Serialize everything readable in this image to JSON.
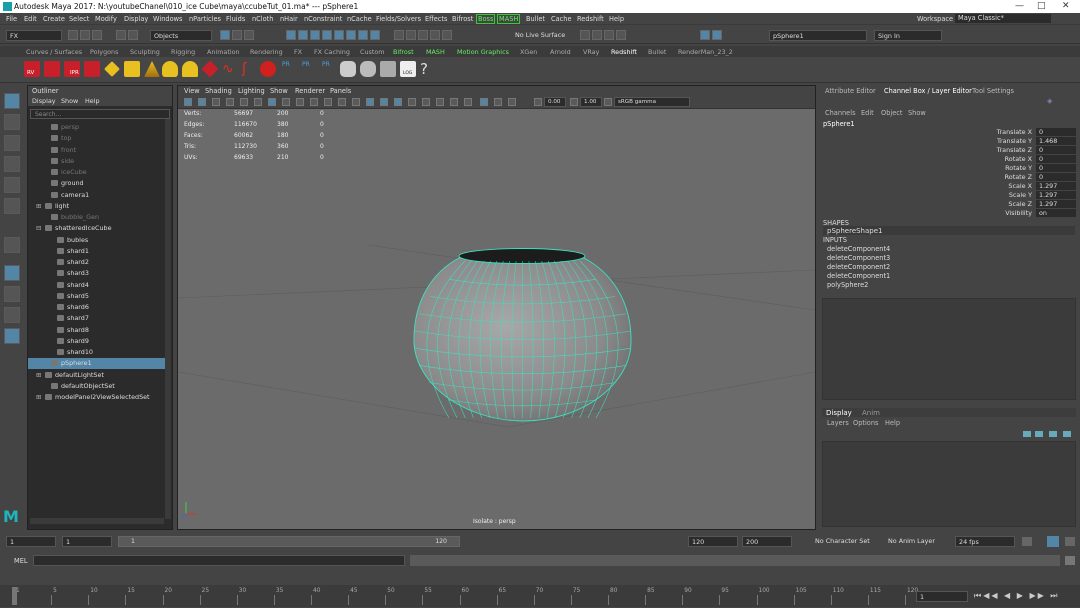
{
  "window": {
    "title": "Autodesk Maya 2017: N:\\youtubeChanel\\010_ice Cube\\maya\\ccubeTut_01.ma*   ---   pSphere1",
    "minimize": "—",
    "maximize": "□",
    "close": "✕"
  },
  "menu": {
    "items": [
      "File",
      "Edit",
      "Create",
      "Select",
      "Modify",
      "Display",
      "Windows",
      "nParticles",
      "Fluids",
      "nCloth",
      "nHair",
      "nConstraint",
      "nCache",
      "Fields/Solvers",
      "Effects",
      "Bifrost",
      "Boss",
      "MASH",
      "Bullet",
      "Cache",
      "Redshift",
      "Help"
    ],
    "workspace_label": "Workspace :",
    "workspace_value": "Maya Classic*"
  },
  "status": {
    "mode": "FX",
    "objects": "Objects",
    "live_surface": "No Live Surface",
    "selection_field": "pSphere1",
    "sign_in": "Sign In"
  },
  "shelf": {
    "tabs": [
      "Curves / Surfaces",
      "Polygons",
      "Sculpting",
      "Rigging",
      "Animation",
      "Rendering",
      "FX",
      "FX Caching",
      "Custom",
      "Bifrost",
      "MASH",
      "Motion Graphics",
      "XGen",
      "Arnold",
      "VRay",
      "Redshift",
      "Bullet",
      "RenderMan_23_2"
    ],
    "active_tab": "Redshift",
    "icon_labels": {
      "rv": "RV",
      "ipr": "IPR",
      "pr1": "PR",
      "pr2": "PR",
      "pr3": "PR",
      "log": "LOG"
    }
  },
  "outliner": {
    "title": "Outliner",
    "menus": [
      "Display",
      "Show",
      "Help"
    ],
    "search_placeholder": "Search...",
    "rows": [
      {
        "label": "persp",
        "dim": true,
        "indent": 1
      },
      {
        "label": "top",
        "dim": true,
        "indent": 1
      },
      {
        "label": "front",
        "dim": true,
        "indent": 1
      },
      {
        "label": "side",
        "dim": true,
        "indent": 1
      },
      {
        "label": "iceCube",
        "dim": true,
        "indent": 1
      },
      {
        "label": "ground",
        "dim": false,
        "indent": 1
      },
      {
        "label": "camera1",
        "dim": false,
        "indent": 1
      },
      {
        "label": "light",
        "dim": false,
        "indent": 0,
        "expander": "+"
      },
      {
        "label": "bubble_Gen",
        "dim": true,
        "indent": 1
      },
      {
        "label": "shatteredIceCube",
        "dim": false,
        "indent": 0,
        "expander": "-"
      },
      {
        "label": "bubles",
        "dim": false,
        "indent": 2
      },
      {
        "label": "shard1",
        "dim": false,
        "indent": 2
      },
      {
        "label": "shard2",
        "dim": false,
        "indent": 2
      },
      {
        "label": "shard3",
        "dim": false,
        "indent": 2
      },
      {
        "label": "shard4",
        "dim": false,
        "indent": 2
      },
      {
        "label": "shard5",
        "dim": false,
        "indent": 2
      },
      {
        "label": "shard6",
        "dim": false,
        "indent": 2
      },
      {
        "label": "shard7",
        "dim": false,
        "indent": 2
      },
      {
        "label": "shard8",
        "dim": false,
        "indent": 2
      },
      {
        "label": "shard9",
        "dim": false,
        "indent": 2
      },
      {
        "label": "shard10",
        "dim": false,
        "indent": 2
      },
      {
        "label": "pSphere1",
        "dim": false,
        "indent": 1,
        "selected": true
      },
      {
        "label": "defaultLightSet",
        "dim": false,
        "indent": 0,
        "expander": "+"
      },
      {
        "label": "defaultObjectSet",
        "dim": false,
        "indent": 1
      },
      {
        "label": "modelPanel2ViewSelectedSet",
        "dim": false,
        "indent": 0,
        "expander": "+"
      }
    ]
  },
  "viewport": {
    "menus": [
      "View",
      "Shading",
      "Lighting",
      "Show",
      "Renderer",
      "Panels"
    ],
    "exposure": "0.00",
    "gamma": "1.00",
    "color_space": "sRGB gamma",
    "footer": "Isolate : persp",
    "hud": [
      {
        "label": "Verts:",
        "a": "56697",
        "b": "200",
        "c": "0"
      },
      {
        "label": "Edges:",
        "a": "116670",
        "b": "380",
        "c": "0"
      },
      {
        "label": "Faces:",
        "a": "60062",
        "b": "180",
        "c": "0"
      },
      {
        "label": "Tris:",
        "a": "112730",
        "b": "360",
        "c": "0"
      },
      {
        "label": "UVs:",
        "a": "69633",
        "b": "210",
        "c": "0"
      }
    ]
  },
  "right_panel": {
    "tabs": [
      "Attribute Editor",
      "Channel Box / Layer Editor",
      "Tool Settings"
    ],
    "active_tab": "Channel Box / Layer Editor",
    "menus": [
      "Channels",
      "Edit",
      "Object",
      "Show"
    ],
    "object": "pSphere1",
    "channels": [
      {
        "label": "Translate X",
        "value": "0"
      },
      {
        "label": "Translate Y",
        "value": "1.468"
      },
      {
        "label": "Translate Z",
        "value": "0"
      },
      {
        "label": "Rotate X",
        "value": "0"
      },
      {
        "label": "Rotate Y",
        "value": "0"
      },
      {
        "label": "Rotate Z",
        "value": "0"
      },
      {
        "label": "Scale X",
        "value": "1.297"
      },
      {
        "label": "Scale Y",
        "value": "1.297"
      },
      {
        "label": "Scale Z",
        "value": "1.297"
      },
      {
        "label": "Visibility",
        "value": "on"
      }
    ],
    "shapes_header": "SHAPES",
    "shape": "pSphereShape1",
    "inputs_header": "INPUTS",
    "inputs": [
      "deleteComponent4",
      "deleteComponent3",
      "deleteComponent2",
      "deleteComponent1",
      "polySphere2"
    ],
    "layer_tabs": [
      "Display",
      "Anim"
    ],
    "layer_menus": [
      "Layers",
      "Options",
      "Help"
    ]
  },
  "time": {
    "start": "1",
    "current_start": "1",
    "range_start": "1",
    "range_end": "120",
    "end": "120",
    "anim_end": "200",
    "character_set": "No Character Set",
    "anim_layer": "No Anim Layer",
    "fps": "24 fps",
    "current_frame": "1",
    "ticks": [
      "1",
      "5",
      "10",
      "15",
      "20",
      "25",
      "30",
      "35",
      "40",
      "45",
      "50",
      "55",
      "60",
      "65",
      "70",
      "75",
      "80",
      "85",
      "90",
      "95",
      "100",
      "105",
      "110",
      "115",
      "120"
    ]
  },
  "cmd": {
    "label": "MEL"
  },
  "colors": {
    "accent": "#5285a6",
    "wire": "#3fe0c0",
    "red": "#d0202a",
    "yellow": "#e8c020",
    "green": "#3ccc3c"
  }
}
